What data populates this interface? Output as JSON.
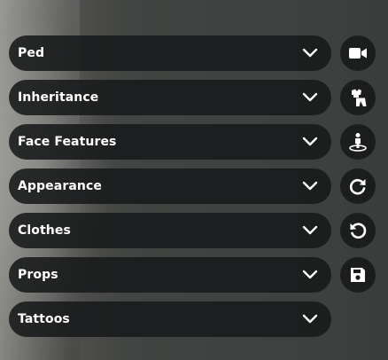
{
  "menu": {
    "sections": [
      {
        "label": "Ped",
        "icon": "chevron-down-icon"
      },
      {
        "label": "Inheritance",
        "icon": "chevron-down-icon"
      },
      {
        "label": "Face Features",
        "icon": "chevron-down-icon"
      },
      {
        "label": "Appearance",
        "icon": "chevron-down-icon"
      },
      {
        "label": "Clothes",
        "icon": "chevron-down-icon"
      },
      {
        "label": "Props",
        "icon": "chevron-down-icon"
      },
      {
        "label": "Tattoos",
        "icon": "chevron-down-icon"
      }
    ]
  },
  "actions": [
    {
      "icon": "video-camera-icon"
    },
    {
      "icon": "clothing-icon"
    },
    {
      "icon": "person-pedestal-icon"
    },
    {
      "icon": "rotate-cw-icon"
    },
    {
      "icon": "undo-icon"
    },
    {
      "icon": "save-icon"
    }
  ],
  "colors": {
    "panel_bg": "#18191a",
    "text": "#ffffff",
    "icon": "#ffffff"
  }
}
